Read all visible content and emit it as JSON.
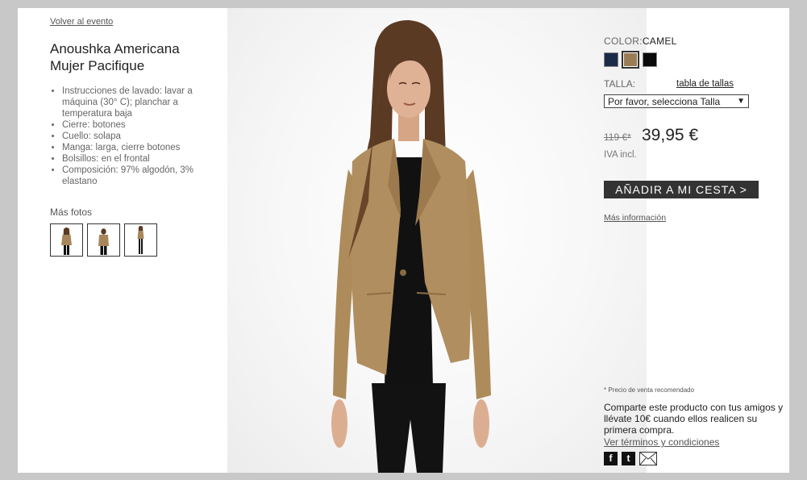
{
  "nav": {
    "back_label": "Volver al evento"
  },
  "product": {
    "title_line1": "Anoushka Americana",
    "title_line2": "Mujer Pacifique",
    "features": [
      "Instrucciones de lavado: lavar a máquina (30° C); planchar a temperatura baja",
      "Cierre: botones",
      "Cuello: solapa",
      "Manga: larga, cierre botones",
      "Bolsillos: en el frontal",
      "Composición: 97% algodón, 3% elastano"
    ],
    "more_photos_label": "Más fotos"
  },
  "options": {
    "color_label": "COLOR:",
    "color_value": "CAMEL",
    "swatches": [
      {
        "name": "navy",
        "hex": "#1c2a4a"
      },
      {
        "name": "camel",
        "hex": "#9a7d55",
        "selected": true
      },
      {
        "name": "black",
        "hex": "#0a0a0a"
      }
    ],
    "size_label": "TALLA:",
    "size_table_link": "tabla de tallas",
    "size_select_value": "Por favor, selecciona Talla",
    "size_select_arrow": "▼"
  },
  "pricing": {
    "old_price": "119 €*",
    "price": "39,95 €",
    "tax_note": "IVA incl."
  },
  "actions": {
    "add_to_cart": "AÑADIR A MI CESTA >",
    "more_info": "Más información"
  },
  "footer": {
    "rrp_note": "* Precio de venta recomendado",
    "share_text": "Comparte este producto con tus amigos y llévate 10€ cuando ellos realicen su primera compra.",
    "terms_link": "Ver términos y condiciones",
    "facebook_glyph": "f",
    "twitter_glyph": "t"
  },
  "colors": {
    "jacket": "#b08e5f",
    "cart_button": "#333333",
    "frame_bg": "#c8c8c8"
  }
}
